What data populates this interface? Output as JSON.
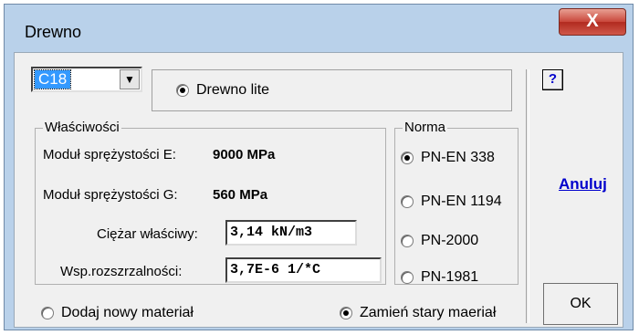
{
  "window": {
    "title": "Drewno",
    "close_label": "X"
  },
  "material": {
    "selected_grade": "C18",
    "type_option": {
      "label": "Drewno lite",
      "checked": true
    }
  },
  "properties": {
    "legend": "Właściwości",
    "modulus_e": {
      "label": "Moduł sprężystości E:",
      "value": "9000 MPa"
    },
    "modulus_g": {
      "label": "Moduł sprężystości G:",
      "value": "560 MPa"
    },
    "specific_weight": {
      "label": "Ciężar właściwy:",
      "value": "3,14 kN/m3"
    },
    "thermal_expansion": {
      "label": "Wsp.rozszrzalności:",
      "value": "3,7E-6 1/*C"
    }
  },
  "norma": {
    "legend": "Norma",
    "options": [
      {
        "label": "PN-EN 338",
        "checked": true
      },
      {
        "label": "PN-EN 1194",
        "checked": false
      },
      {
        "label": "PN-2000",
        "checked": false
      },
      {
        "label": "PN-1981",
        "checked": false
      }
    ]
  },
  "actions": {
    "add_new": {
      "label": "Dodaj nowy materiał",
      "checked": false
    },
    "replace_old": {
      "label": "Zamień stary maeriał",
      "checked": true
    }
  },
  "buttons": {
    "help": "?",
    "cancel": "Anuluj",
    "ok": "OK"
  }
}
